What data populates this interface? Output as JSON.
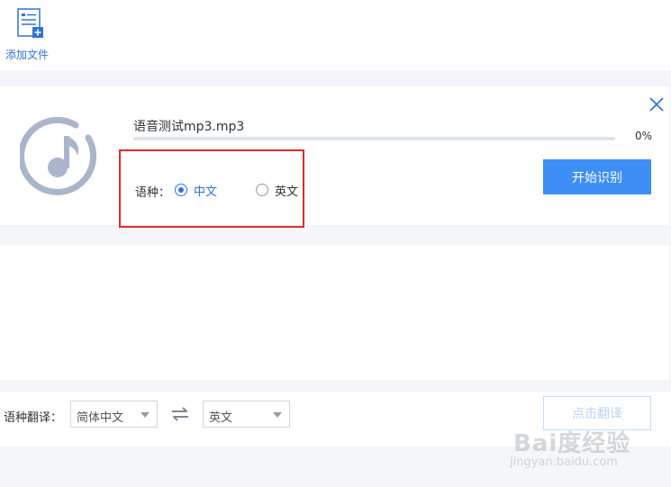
{
  "toolbar": {
    "add_file_label": "添加文件"
  },
  "file": {
    "name": "语音测试mp3.mp3",
    "progress_percent": 0,
    "progress_text": "0%"
  },
  "language": {
    "label": "语种：",
    "options": [
      {
        "label": "中文",
        "selected": true
      },
      {
        "label": "英文",
        "selected": false
      }
    ]
  },
  "actions": {
    "start_label": "开始识别",
    "translate_label": "点击翻译"
  },
  "translate": {
    "label": "语种翻译：",
    "source": "简体中文",
    "target": "英文"
  },
  "watermark": {
    "main": "Bai度经验",
    "sub": "jingyan.baidu.com"
  },
  "colors": {
    "accent": "#3d8ff5",
    "highlight_border": "#e22a2a"
  }
}
